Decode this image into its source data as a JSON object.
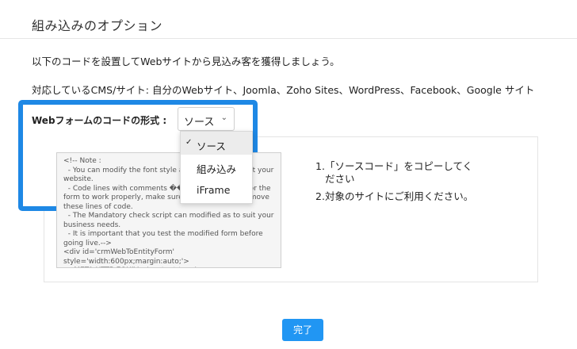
{
  "header": {
    "title": "組み込みのオプション"
  },
  "intro_text": "以下のコードを設置してWebサイトから見込み客を獲得しましょう。",
  "cms_text": "対応しているCMS/サイト: 自分のWebサイト、Joomla、Zoho Sites、WordPress、Facebook、Google サイト",
  "format": {
    "label": "Webフォームのコードの形式 :",
    "selected": "ソース",
    "options": [
      "ソース",
      "組み込み",
      "iFrame"
    ]
  },
  "code_snippet": "<!-- Note :\n  - You can modify the font style and form style to suit your website.\n  - Code lines with comments ���� are required for the form to work properly, make sure that you do not remove these lines of code.\n  - The Mandatory check script can modified as to suit your business needs.\n  - It is important that you test the modified form before going live.-->\n<div id='crmWebToEntityForm' style='width:600px;margin:auto;'>\n  <META HTTP-EQUIV ='content-type'",
  "steps": [
    {
      "num": "1.",
      "text": "「ソースコード」をコピーしてください"
    },
    {
      "num": "2.",
      "text": "対象のサイトにご利用ください。"
    }
  ],
  "actions": {
    "done_label": "完了"
  }
}
